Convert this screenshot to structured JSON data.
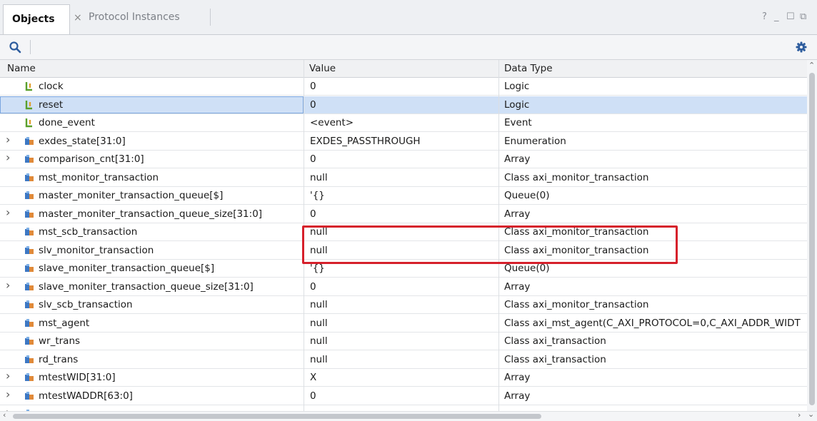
{
  "tabs": {
    "active": "Objects",
    "inactive": "Protocol Instances",
    "close_glyph": "×"
  },
  "window_controls": {
    "help": "?",
    "minimize": "_",
    "maximize": "☐",
    "float": "⧉"
  },
  "toolbar": {
    "search_icon": "search-icon",
    "settings_icon": "gear-icon"
  },
  "columns": {
    "name": "Name",
    "value": "Value",
    "type": "Data Type"
  },
  "rows": [
    {
      "name": "clock",
      "value": "0",
      "type": "Logic",
      "expandable": false,
      "icon": "signal-icon"
    },
    {
      "name": "reset",
      "value": "0",
      "type": "Logic",
      "expandable": false,
      "icon": "signal-icon"
    },
    {
      "name": "done_event",
      "value": "<event>",
      "type": "Event",
      "expandable": false,
      "icon": "signal-icon"
    },
    {
      "name": "exdes_state[31:0]",
      "value": "EXDES_PASSTHROUGH",
      "type": "Enumeration",
      "expandable": true,
      "icon": "variable-icon"
    },
    {
      "name": "comparison_cnt[31:0]",
      "value": "0",
      "type": "Array",
      "expandable": true,
      "icon": "variable-icon"
    },
    {
      "name": "mst_monitor_transaction",
      "value": "null",
      "type": "Class axi_monitor_transaction",
      "expandable": false,
      "icon": "variable-icon"
    },
    {
      "name": "master_moniter_transaction_queue[$]",
      "value": "'{}",
      "type": "Queue(0)",
      "expandable": false,
      "icon": "variable-icon"
    },
    {
      "name": "master_moniter_transaction_queue_size[31:0]",
      "value": "0",
      "type": "Array",
      "expandable": true,
      "icon": "variable-icon"
    },
    {
      "name": "mst_scb_transaction",
      "value": "null",
      "type": "Class axi_monitor_transaction",
      "expandable": false,
      "icon": "variable-icon"
    },
    {
      "name": "slv_monitor_transaction",
      "value": "null",
      "type": "Class axi_monitor_transaction",
      "expandable": false,
      "icon": "variable-icon"
    },
    {
      "name": "slave_moniter_transaction_queue[$]",
      "value": "'{}",
      "type": "Queue(0)",
      "expandable": false,
      "icon": "variable-icon"
    },
    {
      "name": "slave_moniter_transaction_queue_size[31:0]",
      "value": "0",
      "type": "Array",
      "expandable": true,
      "icon": "variable-icon"
    },
    {
      "name": "slv_scb_transaction",
      "value": "null",
      "type": "Class axi_monitor_transaction",
      "expandable": false,
      "icon": "variable-icon"
    },
    {
      "name": "mst_agent",
      "value": "null",
      "type": "Class axi_mst_agent(C_AXI_PROTOCOL=0,C_AXI_ADDR_WIDT",
      "expandable": false,
      "icon": "variable-icon"
    },
    {
      "name": "wr_trans",
      "value": "null",
      "type": "Class axi_transaction",
      "expandable": false,
      "icon": "variable-icon"
    },
    {
      "name": "rd_trans",
      "value": "null",
      "type": "Class axi_transaction",
      "expandable": false,
      "icon": "variable-icon"
    },
    {
      "name": "mtestWID[31:0]",
      "value": "X",
      "type": "Array",
      "expandable": true,
      "icon": "variable-icon"
    },
    {
      "name": "mtestWADDR[63:0]",
      "value": "0",
      "type": "Array",
      "expandable": true,
      "icon": "variable-icon"
    },
    {
      "name": "",
      "value": "",
      "type": "",
      "expandable": true,
      "icon": "variable-icon"
    }
  ],
  "selected_row": 1,
  "highlight_rows": [
    5,
    6
  ],
  "colors": {
    "selection": "#cfe0f6",
    "highlight_border": "#d6202b",
    "signal_icon": "#5aa02c",
    "variable_icon": "#3d78c4"
  }
}
